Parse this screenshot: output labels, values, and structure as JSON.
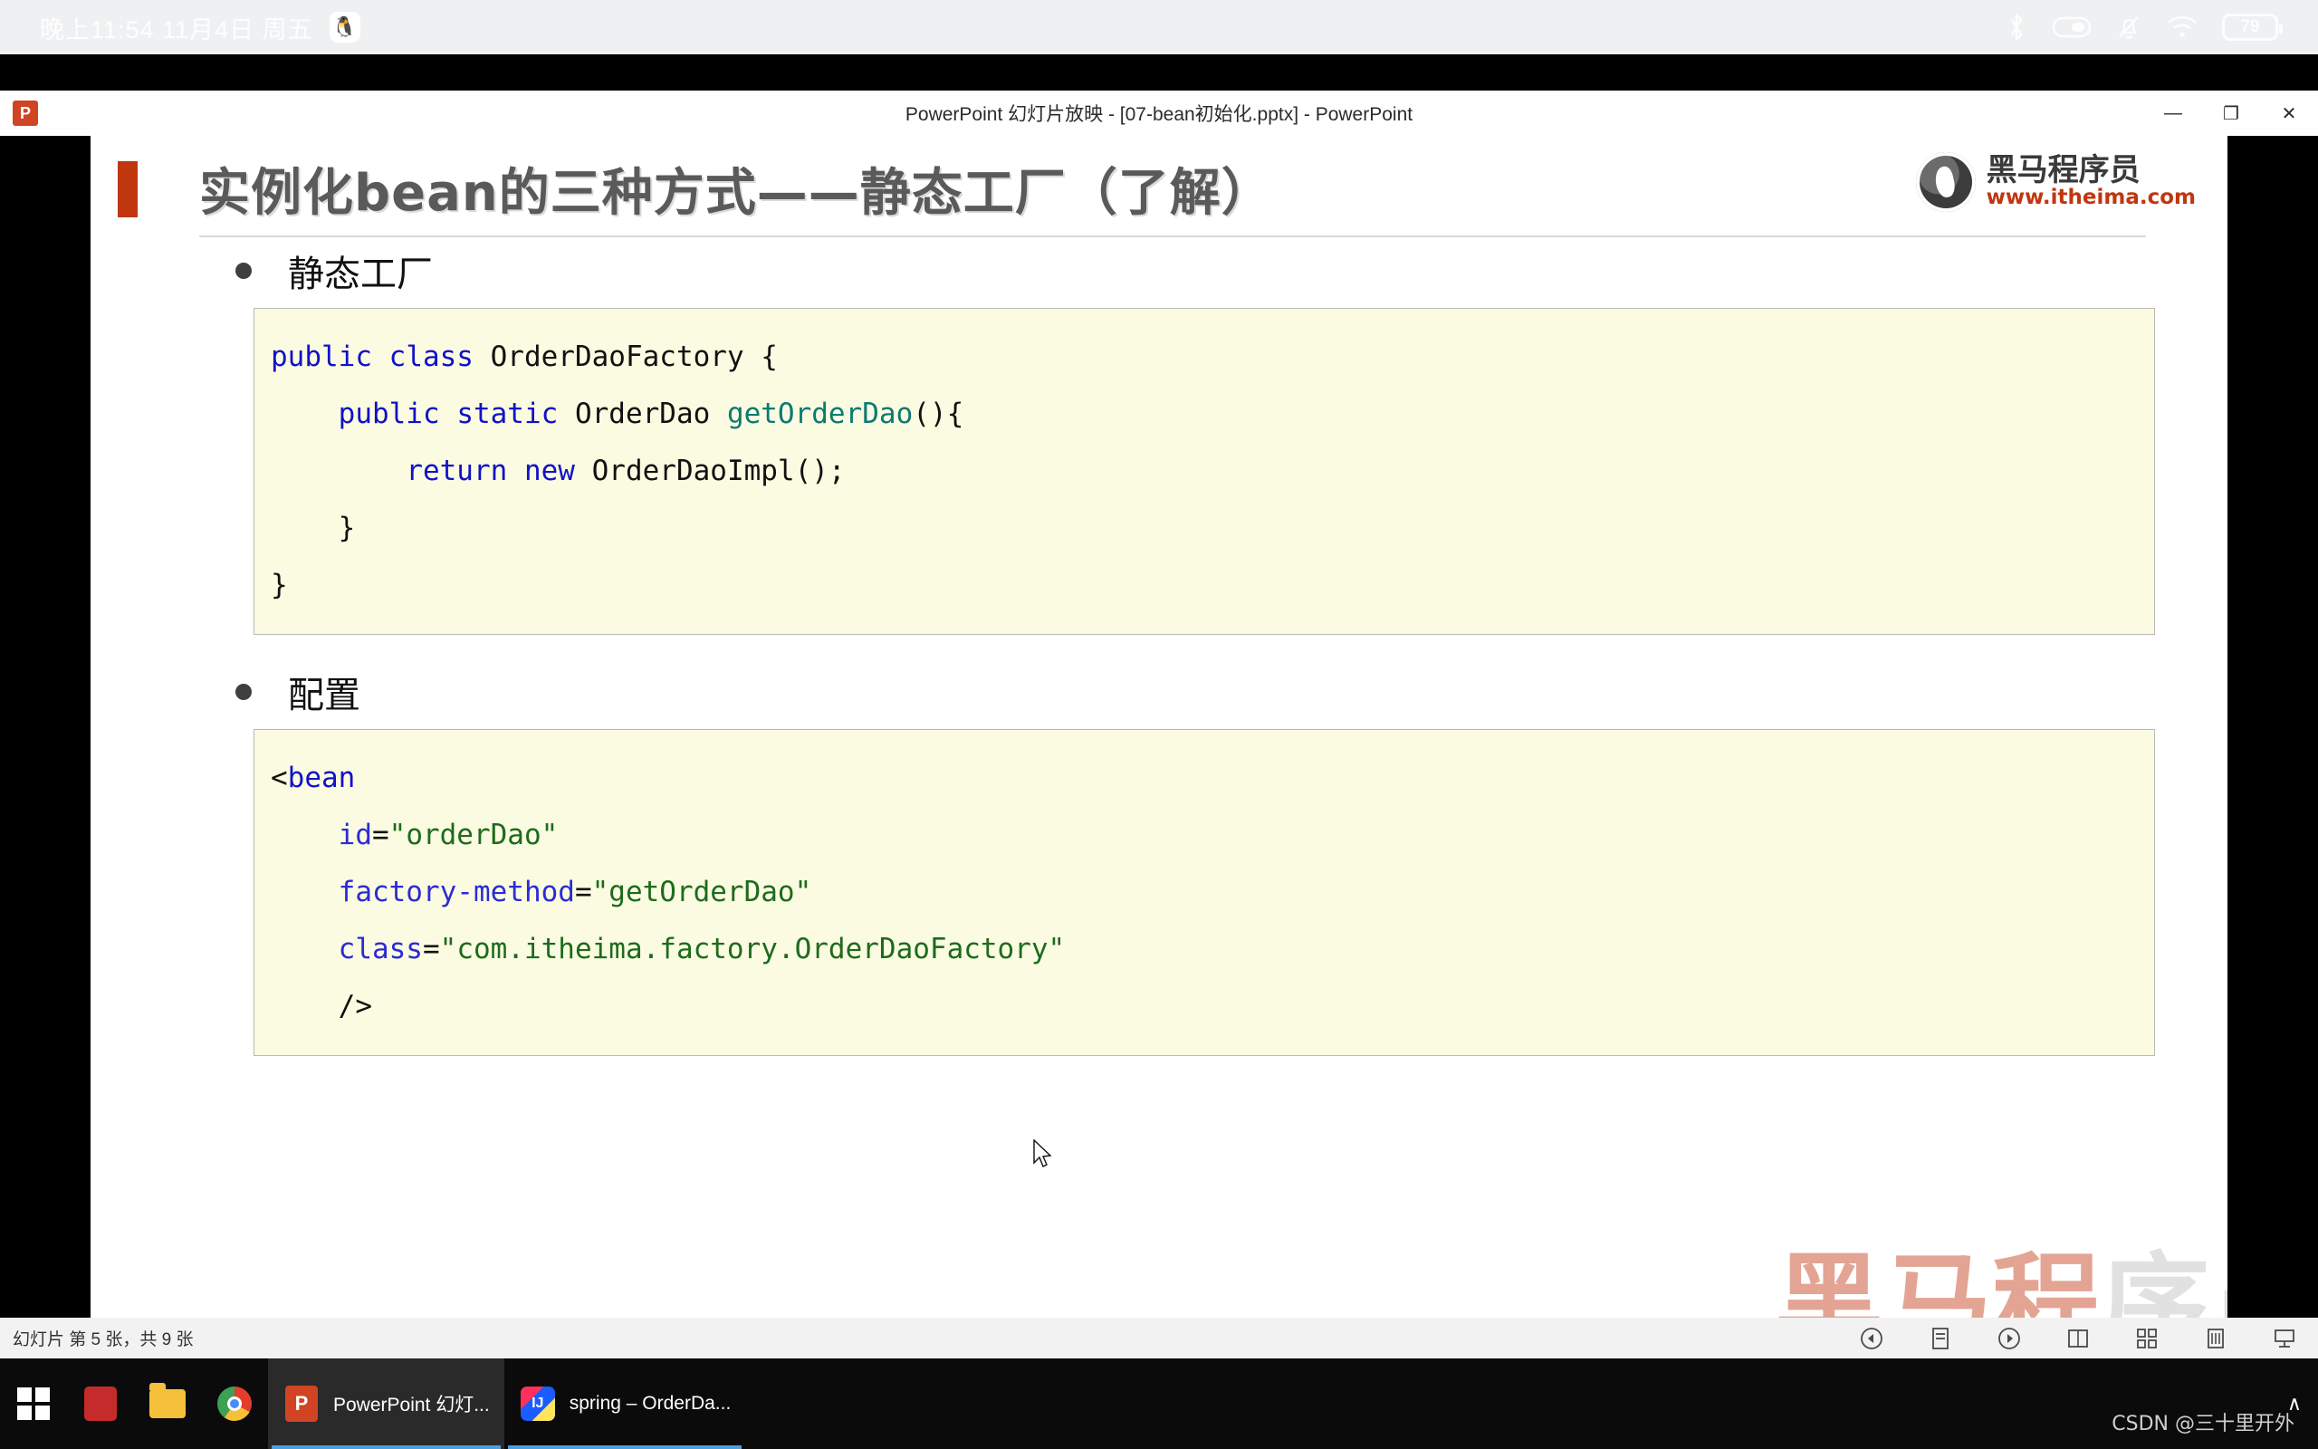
{
  "topbar": {
    "clock": "晚上11:54  11月4日  周五",
    "qq_icon": "penguin-icon",
    "icons": [
      "bluetooth-icon",
      "toggle-icon",
      "mute-bell-icon",
      "wifi-icon"
    ],
    "battery_level": "79"
  },
  "window": {
    "app_icon": "powerpoint-icon",
    "title": "PowerPoint 幻灯片放映 - [07-bean初始化.pptx] - PowerPoint",
    "minimize_label": "—",
    "restore_label": "❐",
    "close_label": "✕"
  },
  "slide": {
    "title": "实例化bean的三种方式——静态工厂（了解）",
    "accent_color": "#c0360f",
    "logo": {
      "mark": "horse-logo-icon",
      "name": "黑马程序员",
      "url": "www.itheima.com"
    },
    "section1": {
      "bullet": "静态工厂",
      "code_lines": [
        [
          {
            "t": "public",
            "c": "kw"
          },
          {
            "t": " ",
            "c": ""
          },
          {
            "t": "class",
            "c": "kw"
          },
          {
            "t": " OrderDaoFactory {",
            "c": ""
          }
        ],
        [
          {
            "t": "    ",
            "c": ""
          },
          {
            "t": "public",
            "c": "kw"
          },
          {
            "t": " ",
            "c": ""
          },
          {
            "t": "static",
            "c": "kw"
          },
          {
            "t": " OrderDao ",
            "c": ""
          },
          {
            "t": "getOrderDao",
            "c": "mth"
          },
          {
            "t": "(){",
            "c": ""
          }
        ],
        [
          {
            "t": "        ",
            "c": ""
          },
          {
            "t": "return",
            "c": "kw"
          },
          {
            "t": " ",
            "c": ""
          },
          {
            "t": "new",
            "c": "kw"
          },
          {
            "t": " OrderDaoImpl();",
            "c": ""
          }
        ],
        [
          {
            "t": "    }",
            "c": ""
          }
        ],
        [
          {
            "t": "}",
            "c": ""
          }
        ]
      ]
    },
    "section2": {
      "bullet": "配置",
      "code_lines": [
        [
          {
            "t": "<",
            "c": ""
          },
          {
            "t": "bean",
            "c": "tag"
          }
        ],
        [
          {
            "t": "    ",
            "c": ""
          },
          {
            "t": "id",
            "c": "att"
          },
          {
            "t": "=",
            "c": ""
          },
          {
            "t": "\"orderDao\"",
            "c": "str"
          }
        ],
        [
          {
            "t": "    ",
            "c": ""
          },
          {
            "t": "factory-method",
            "c": "att"
          },
          {
            "t": "=",
            "c": ""
          },
          {
            "t": "\"getOrderDao\"",
            "c": "str"
          }
        ],
        [
          {
            "t": "    ",
            "c": ""
          },
          {
            "t": "class",
            "c": "att"
          },
          {
            "t": "=",
            "c": ""
          },
          {
            "t": "\"com.itheima.factory.OrderDaoFactory\"",
            "c": "str"
          }
        ],
        [
          {
            "t": "    />",
            "c": ""
          }
        ]
      ]
    },
    "watermark": "黑马程序员"
  },
  "statusbar": {
    "text": "幻灯片 第 5 张，共 9 张",
    "tools": [
      "prev-slide-icon",
      "pen-tool-icon",
      "next-slide-icon",
      "presenter-view-icon",
      "all-slides-icon",
      "zoom-icon",
      "end-show-icon"
    ]
  },
  "taskbar": {
    "items": [
      {
        "icon": "windows-start-icon",
        "label": "",
        "state": "idle"
      },
      {
        "icon": "red-app-icon",
        "label": "",
        "state": "idle"
      },
      {
        "icon": "file-explorer-icon",
        "label": "",
        "state": "idle"
      },
      {
        "icon": "chrome-icon",
        "label": "",
        "state": "idle"
      },
      {
        "icon": "powerpoint-icon",
        "label": "PowerPoint 幻灯...",
        "state": "active"
      },
      {
        "icon": "intellij-idea-icon",
        "label": "spring – OrderDa...",
        "state": "running"
      }
    ],
    "tray_chevron": "∧"
  },
  "overlay": {
    "csdn_watermark": "CSDN @三十里开外"
  }
}
